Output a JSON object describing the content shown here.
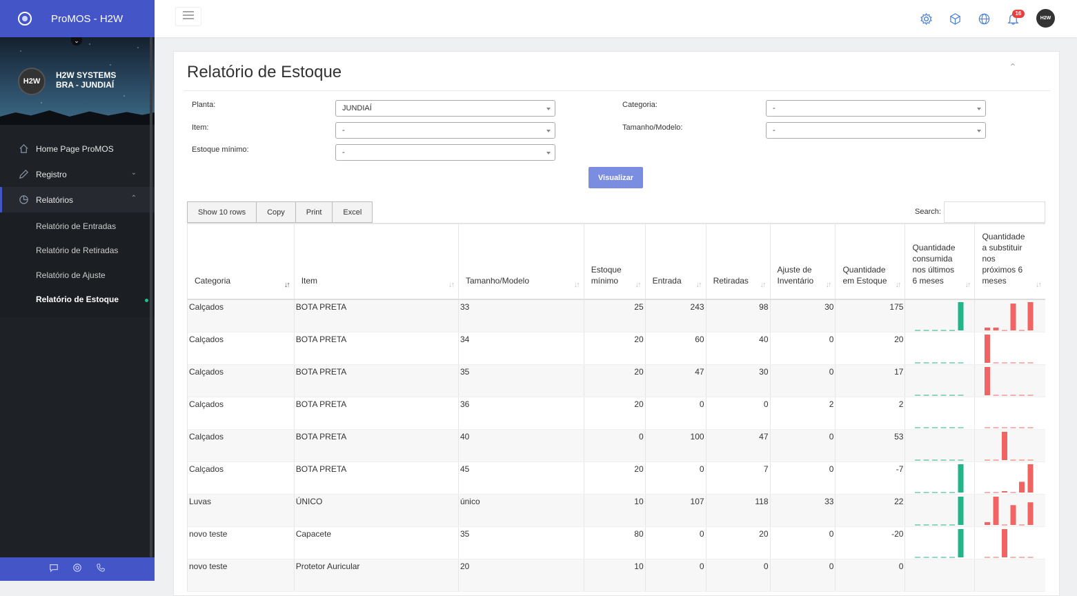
{
  "app": {
    "title": "ProMOS - H2W"
  },
  "user": {
    "avatar": "H2W",
    "company": "H2W SYSTEMS",
    "location": "BRA - JUNDIAÍ"
  },
  "sidebar": {
    "items": [
      {
        "label": "Home Page ProMOS",
        "icon": "home-icon"
      },
      {
        "label": "Registro",
        "icon": "pencil-icon"
      },
      {
        "label": "Relatórios",
        "icon": "pie-chart-icon"
      }
    ],
    "subitems": [
      {
        "label": "Relatório de Entradas"
      },
      {
        "label": "Relatório de Retiradas"
      },
      {
        "label": "Relatório de Ajuste"
      },
      {
        "label": "Relatório de Estoque"
      }
    ]
  },
  "topbar": {
    "notifications": "16",
    "avatar": "H2W"
  },
  "page": {
    "title": "Relatório de Estoque"
  },
  "filters": {
    "planta": {
      "label": "Planta:",
      "value": "JUNDIAÍ"
    },
    "categoria": {
      "label": "Categoria:",
      "value": "-"
    },
    "item": {
      "label": "Item:",
      "value": "-"
    },
    "tamanho": {
      "label": "Tamanho/Modelo:",
      "value": "-"
    },
    "estoque": {
      "label": "Estoque mínimo:",
      "value": "-"
    },
    "submit": "Visualizar"
  },
  "table_tools": {
    "show_rows": "Show 10 rows",
    "copy": "Copy",
    "print": "Print",
    "excel": "Excel",
    "search_label": "Search:"
  },
  "table": {
    "columns": [
      "Categoria",
      "Item",
      "Tamanho/Modelo",
      "Estoque mínimo",
      "Entrada",
      "Retiradas",
      "Ajuste de Inventário",
      "Quantidade em Estoque",
      "Quantidade consumida nos últimos 6 meses",
      "Quantidade a substituir nos próximos 6 meses"
    ],
    "rows": [
      {
        "categoria": "Calçados",
        "item": "BOTA PRETA",
        "tamanho": "33",
        "estoque_min": "25",
        "entrada": "243",
        "retiradas": "98",
        "ajuste": "30",
        "qtd": "175",
        "consumo": [
          0,
          0,
          0,
          0,
          0,
          100
        ],
        "substituir": [
          10,
          10,
          0,
          95,
          0,
          100
        ]
      },
      {
        "categoria": "Calçados",
        "item": "BOTA PRETA",
        "tamanho": "34",
        "estoque_min": "20",
        "entrada": "60",
        "retiradas": "40",
        "ajuste": "0",
        "qtd": "20",
        "consumo": [
          0,
          0,
          0,
          0,
          0,
          0
        ],
        "substituir": [
          100,
          0,
          0,
          0,
          0,
          0
        ]
      },
      {
        "categoria": "Calçados",
        "item": "BOTA PRETA",
        "tamanho": "35",
        "estoque_min": "20",
        "entrada": "47",
        "retiradas": "30",
        "ajuste": "0",
        "qtd": "17",
        "consumo": [
          0,
          0,
          0,
          0,
          0,
          0
        ],
        "substituir": [
          100,
          0,
          0,
          0,
          0,
          0
        ]
      },
      {
        "categoria": "Calçados",
        "item": "BOTA PRETA",
        "tamanho": "36",
        "estoque_min": "20",
        "entrada": "0",
        "retiradas": "0",
        "ajuste": "2",
        "qtd": "2",
        "consumo": [
          0,
          0,
          0,
          0,
          0,
          0
        ],
        "substituir": [
          0,
          0,
          0,
          0,
          0,
          0
        ]
      },
      {
        "categoria": "Calçados",
        "item": "BOTA PRETA",
        "tamanho": "40",
        "estoque_min": "0",
        "entrada": "100",
        "retiradas": "47",
        "ajuste": "0",
        "qtd": "53",
        "consumo": [
          0,
          0,
          0,
          0,
          0,
          0
        ],
        "substituir": [
          0,
          0,
          100,
          0,
          0,
          0
        ]
      },
      {
        "categoria": "Calçados",
        "item": "BOTA PRETA",
        "tamanho": "45",
        "estoque_min": "20",
        "entrada": "0",
        "retiradas": "7",
        "ajuste": "0",
        "qtd": "-7",
        "consumo": [
          0,
          0,
          0,
          0,
          0,
          100
        ],
        "substituir": [
          0,
          0,
          5,
          0,
          38,
          100
        ]
      },
      {
        "categoria": "Luvas",
        "item": "ÚNICO",
        "tamanho": "único",
        "estoque_min": "10",
        "entrada": "107",
        "retiradas": "118",
        "ajuste": "33",
        "qtd": "22",
        "consumo": [
          0,
          0,
          0,
          0,
          0,
          100
        ],
        "substituir": [
          10,
          100,
          0,
          70,
          0,
          80
        ]
      },
      {
        "categoria": "novo teste",
        "item": "Capacete",
        "tamanho": "35",
        "estoque_min": "80",
        "entrada": "0",
        "retiradas": "20",
        "ajuste": "0",
        "qtd": "-20",
        "consumo": [
          0,
          0,
          0,
          0,
          0,
          100
        ],
        "substituir": [
          0,
          0,
          100,
          0,
          0,
          0
        ]
      },
      {
        "categoria": "novo teste",
        "item": "Protetor Auricular",
        "tamanho": "20",
        "estoque_min": "10",
        "entrada": "0",
        "retiradas": "0",
        "ajuste": "0",
        "qtd": "0",
        "consumo": [],
        "substituir": []
      }
    ]
  },
  "colors": {
    "brand": "#4455c8",
    "consumed_bar": "#21b58a",
    "replace_bar": "#f06464",
    "button": "#7a8de0"
  }
}
